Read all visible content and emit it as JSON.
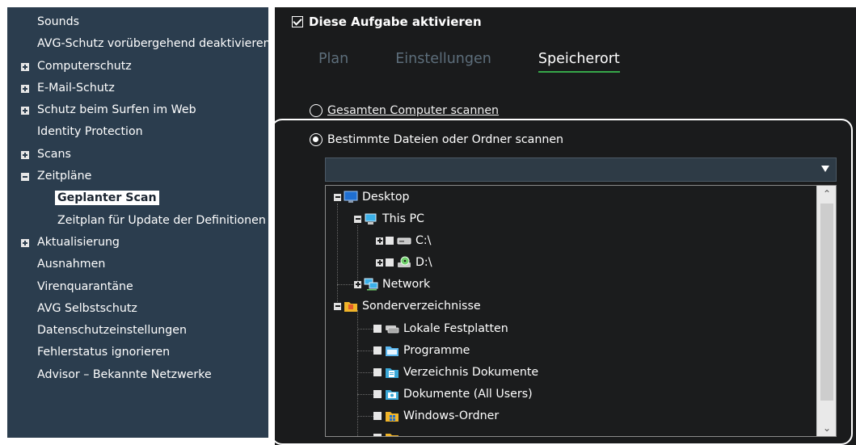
{
  "sidebar": {
    "items": [
      {
        "label": "Sounds",
        "level": 0,
        "toggle": ""
      },
      {
        "label": "AVG-Schutz vorübergehend deaktivieren",
        "level": 0,
        "toggle": ""
      },
      {
        "label": "Computerschutz",
        "level": 0,
        "toggle": "plus"
      },
      {
        "label": "E-Mail-Schutz",
        "level": 0,
        "toggle": "plus"
      },
      {
        "label": "Schutz beim Surfen im Web",
        "level": 0,
        "toggle": "plus"
      },
      {
        "label": "Identity Protection",
        "level": 0,
        "toggle": ""
      },
      {
        "label": "Scans",
        "level": 0,
        "toggle": "plus"
      },
      {
        "label": "Zeitpläne",
        "level": 0,
        "toggle": "minus"
      },
      {
        "label": "Geplanter Scan",
        "level": 1,
        "toggle": "",
        "selected": true
      },
      {
        "label": "Zeitplan für Update der Definitionen",
        "level": 1,
        "toggle": ""
      },
      {
        "label": "Aktualisierung",
        "level": 0,
        "toggle": "plus"
      },
      {
        "label": "Ausnahmen",
        "level": 0,
        "toggle": ""
      },
      {
        "label": "Virenquarantäne",
        "level": 0,
        "toggle": ""
      },
      {
        "label": "AVG Selbstschutz",
        "level": 0,
        "toggle": ""
      },
      {
        "label": "Datenschutzeinstellungen",
        "level": 0,
        "toggle": ""
      },
      {
        "label": "Fehlerstatus ignorieren",
        "level": 0,
        "toggle": ""
      },
      {
        "label": "Advisor – Bekannte Netzwerke",
        "level": 0,
        "toggle": ""
      }
    ]
  },
  "main": {
    "enable_task": {
      "label": "Diese Aufgabe aktivieren",
      "checked": true
    },
    "tabs": [
      {
        "label": "Plan",
        "active": false
      },
      {
        "label": "Einstellungen",
        "active": false
      },
      {
        "label": "Speicherort",
        "active": true
      }
    ],
    "radio_whole": "Gesamten Computer scannen",
    "radio_specific": "Bestimmte Dateien oder Ordner scannen",
    "path_value": "",
    "tree": [
      {
        "label": "Desktop",
        "icon": "desktop-icon"
      },
      {
        "label": "This PC",
        "icon": "computer-icon"
      },
      {
        "label": "C:\\",
        "icon": "drive-icon"
      },
      {
        "label": "D:\\",
        "icon": "dvd-drive-icon"
      },
      {
        "label": "Network",
        "icon": "network-icon"
      },
      {
        "label": "Sonderverzeichnisse",
        "icon": "special-folder-icon"
      },
      {
        "label": "Lokale Festplatten",
        "icon": "local-disks-icon"
      },
      {
        "label": "Programme",
        "icon": "folder-icon"
      },
      {
        "label": "Verzeichnis Dokumente",
        "icon": "documents-icon"
      },
      {
        "label": "Dokumente (All Users)",
        "icon": "shared-documents-icon"
      },
      {
        "label": "Windows-Ordner",
        "icon": "windows-folder-icon"
      },
      {
        "label": "",
        "icon": "folder-icon"
      }
    ]
  },
  "colors": {
    "sidebar_bg": "#2b3d4e",
    "main_bg": "#1a1b1c",
    "active_tab_underline": "#37a84a",
    "inactive_tab": "#5d6e7b"
  }
}
